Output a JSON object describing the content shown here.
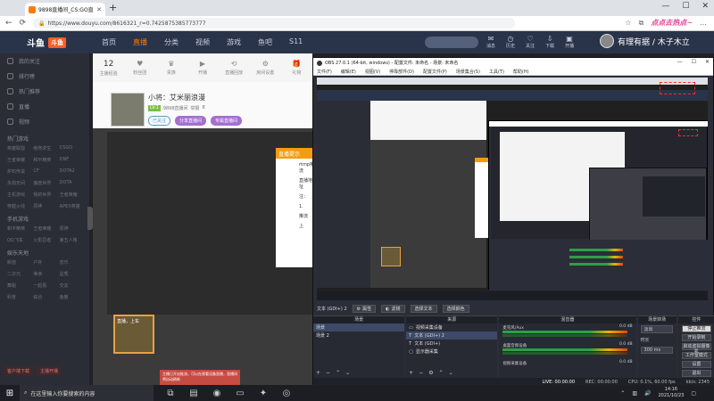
{
  "browser": {
    "tab_title": "9898直播间_CS:GO直播_斗鱼直播",
    "url": "https://www.douyu.com/8616321_r=0.7425875385773777",
    "brand_text": "点点去热点~"
  },
  "site": {
    "logo_text": "斗鱼",
    "logo_badge": "斗鱼",
    "nav": [
      "首页",
      "直播",
      "分类",
      "视频",
      "游戏",
      "鱼吧",
      "S11"
    ],
    "nav_active_index": 1,
    "header_icons": [
      "消息",
      "历史",
      "关注",
      "下载",
      "开播"
    ],
    "username": "有理有据 / 木子木立"
  },
  "sidebar": {
    "items": [
      "我的关注",
      "排行榜",
      "热门推荐",
      "直播",
      "视频"
    ],
    "sections": [
      {
        "title": "热门游戏",
        "entries": [
          "英雄联盟",
          "绝地求生",
          "CSGO",
          "王者荣耀",
          "和平精英",
          "DNF",
          "炉石传说",
          "CF",
          "DOTA2",
          "永劫无间",
          "魔兽世界",
          "DOTA",
          "主机游戏",
          "我的世界",
          "王者荣耀",
          "穿越火线",
          "原神",
          "APEX英雄"
        ]
      },
      {
        "title": "手机游戏",
        "entries": [
          "和平精英",
          "王者荣耀",
          "原神",
          "QQ飞车",
          "火影忍者",
          "第五人格"
        ]
      },
      {
        "title": "娱乐天地",
        "entries": [
          "颜值",
          "户外",
          "音乐",
          "二次元",
          "美食",
          "星秀",
          "舞蹈",
          "一起看",
          "交友",
          "科普",
          "综合",
          "鱼教"
        ]
      }
    ],
    "bottom_buttons": [
      "客户端下载",
      "主播开播"
    ]
  },
  "main": {
    "stats": [
      {
        "value": "12",
        "label": "主播经验"
      },
      {
        "value": "",
        "label": "粉丝团"
      },
      {
        "value": "",
        "label": "贵族"
      },
      {
        "value": "",
        "label": "开播"
      },
      {
        "value": "",
        "label": "直播回放"
      },
      {
        "value": "",
        "label": "房间设置"
      },
      {
        "value": "",
        "label": "礼物"
      },
      {
        "value": "",
        "label": "更多"
      }
    ],
    "room_name": "小将：艾米丽浪漫",
    "room_tags": [
      "LV.1",
      "9898直播间",
      "举报",
      "8"
    ],
    "room_buttons": [
      "已关注",
      "分享直播间",
      "专属直播间"
    ],
    "popup_header": "直播提示",
    "popup_lines": [
      "rtmp推流",
      "直播地址",
      "注：",
      "1.",
      "推流",
      "上"
    ],
    "mini_label": "直播，上车",
    "toast_text": "主播已开启推流，可以在观看设备直播，直播间将自动刷新"
  },
  "obs": {
    "title": "OBS 27.0.1 (64-bit, windows) - 配置文件: 未命名 - 场景: 未命名",
    "menu": [
      "文件(F)",
      "编辑(E)",
      "视图(V)",
      "停靠部件(D)",
      "配置文件(P)",
      "场景集合(S)",
      "工具(T)",
      "帮助(H)"
    ],
    "source_label": "文本 (GDI+) 2",
    "props_button": "属性",
    "filter_button": "滤镜",
    "text_select": "选择文本",
    "text_edit": "选择颜色",
    "docks": {
      "scenes": {
        "title": "场景",
        "items": [
          "场景",
          "场景 2"
        ]
      },
      "sources": {
        "title": "来源",
        "items": [
          "视频采集设备",
          "文本 (GDI+) 2",
          "文本 (GDI+)",
          "显示器采集"
        ]
      },
      "mixer": {
        "title": "混音器",
        "channels": [
          {
            "name": "麦克风/Aux",
            "db": "0.0 dB"
          },
          {
            "name": "桌面音频设备",
            "db": "0.0 dB"
          },
          {
            "name": "视频采集设备",
            "db": "0.0 dB"
          }
        ]
      },
      "transitions": {
        "title": "场景转场",
        "effect": "淡出",
        "duration_label": "时长",
        "duration": "300 ms"
      },
      "controls": {
        "title": "控件",
        "buttons": [
          "停止推流",
          "开始录制",
          "启动虚拟摄像机",
          "工作室模式",
          "设置",
          "退出"
        ]
      }
    },
    "status": {
      "drop": "LIVE: 00:00:00",
      "live": "REC: 00:00:00",
      "cpu": "CPU: 0.1%, 60.00 fps",
      "kbps": "kb/s: 2345"
    }
  },
  "taskbar": {
    "search_placeholder": "在这里输入你要搜索的内容",
    "time": "14:16",
    "date": "2021/10/23"
  },
  "colors": {
    "douyu_header": "#29344a",
    "accent_orange": "#ff7a00",
    "obs_bg": "#2b2e38",
    "taskbar": "#1c1e24"
  }
}
